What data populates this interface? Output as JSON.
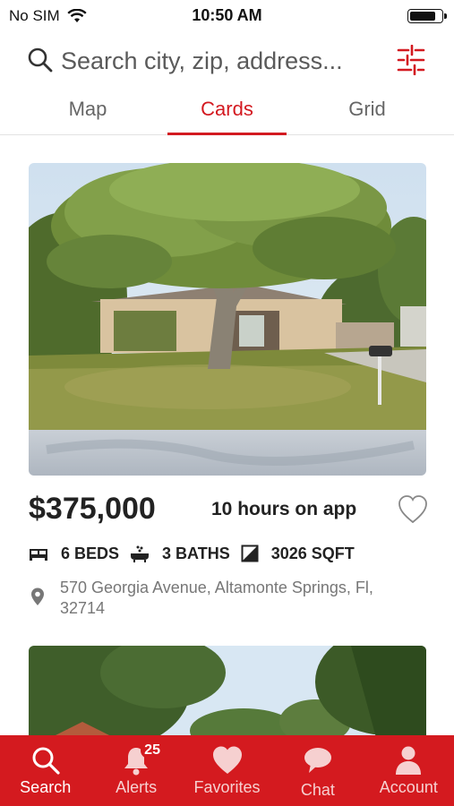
{
  "status_bar": {
    "carrier": "No SIM",
    "time": "10:50 AM",
    "battery_level": 0.85
  },
  "search": {
    "placeholder": "Search city, zip, address..."
  },
  "tabs": [
    {
      "label": "Map",
      "active": false
    },
    {
      "label": "Cards",
      "active": true
    },
    {
      "label": "Grid",
      "active": false
    }
  ],
  "listing": {
    "price": "$375,000",
    "time_on_app": "10 hours on app",
    "beds": "6 BEDS",
    "baths": "3 BATHS",
    "sqft": "3026 SQFT",
    "address": "570 Georgia Avenue, Altamonte Springs, Fl, 32714"
  },
  "bottom_nav": {
    "items": [
      {
        "label": "Search",
        "icon": "search-icon",
        "active": true
      },
      {
        "label": "Alerts",
        "icon": "bell-icon",
        "badge": "25"
      },
      {
        "label": "Favorites",
        "icon": "heart-icon"
      },
      {
        "label": "Chat",
        "icon": "chat-bubble-icon"
      },
      {
        "label": "Account",
        "icon": "person-icon"
      }
    ]
  },
  "colors": {
    "accent": "#d31920",
    "nav_background": "#d41a1f"
  }
}
